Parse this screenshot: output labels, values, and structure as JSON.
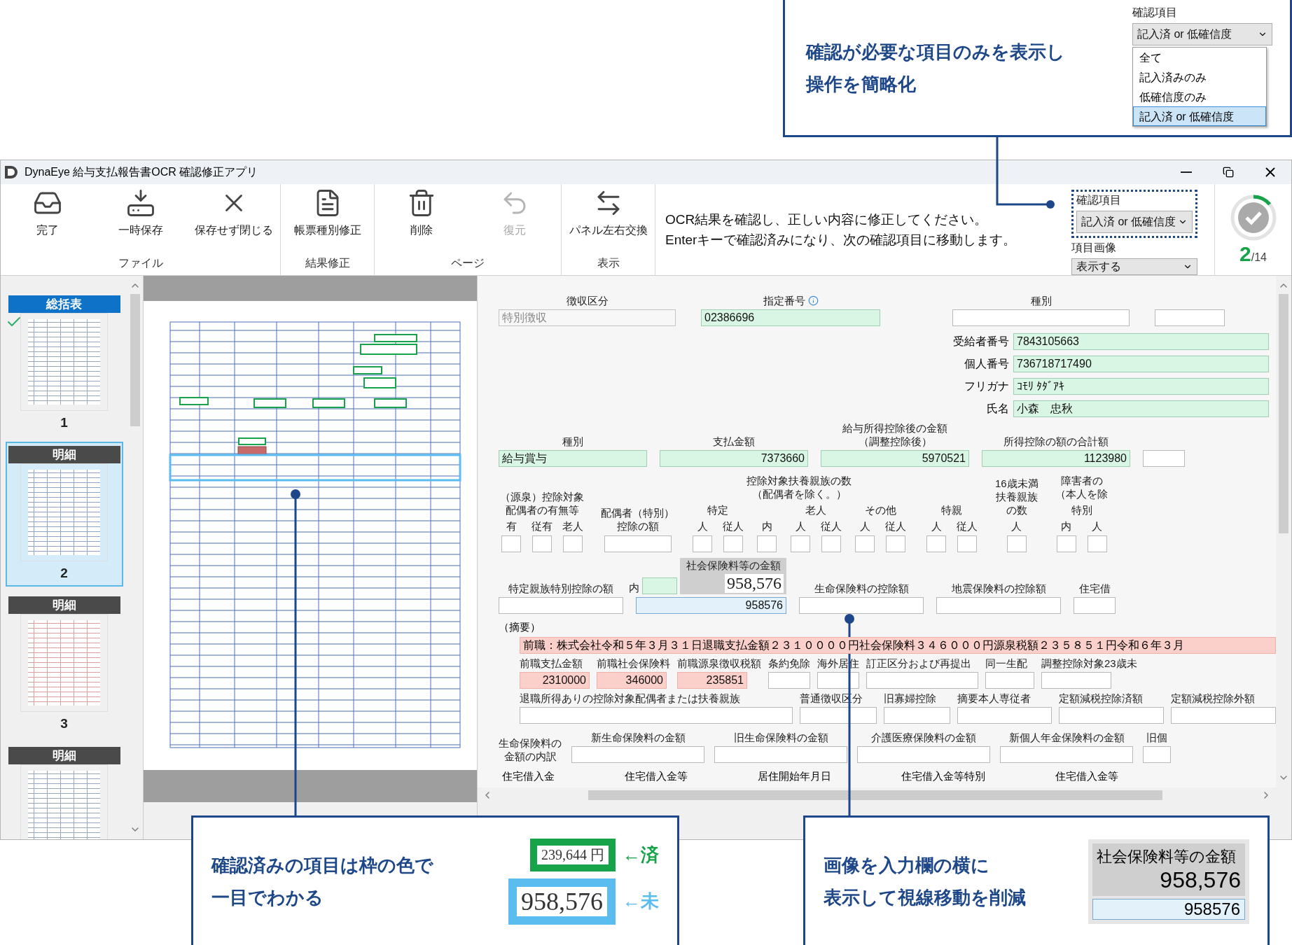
{
  "callout_top": {
    "lines": [
      "確認が必要な項目のみを表示し",
      "操作を簡略化"
    ],
    "dropdown": {
      "label": "確認項目",
      "value": "記入済 or 低確信度",
      "options": [
        {
          "label": "全て",
          "selected": false
        },
        {
          "label": "記入済みのみ",
          "selected": false
        },
        {
          "label": "低確信度のみ",
          "selected": false
        },
        {
          "label": "記入済 or 低確信度",
          "selected": true
        }
      ]
    }
  },
  "window": {
    "title": "DynaEye 給与支払報告書OCR 確認修正アプリ"
  },
  "toolbar": {
    "groups": [
      {
        "label": "ファイル",
        "buttons": [
          {
            "label": "完了",
            "disabled": false
          },
          {
            "label": "一時保存",
            "disabled": false
          },
          {
            "label": "保存せず閉じる",
            "disabled": false
          }
        ]
      },
      {
        "label": "結果修正",
        "buttons": [
          {
            "label": "帳票種別修正",
            "disabled": false
          }
        ]
      },
      {
        "label": "ページ",
        "buttons": [
          {
            "label": "削除",
            "disabled": false
          },
          {
            "label": "復元",
            "disabled": true
          }
        ]
      },
      {
        "label": "表示",
        "buttons": [
          {
            "label": "パネル左右交換",
            "disabled": false
          }
        ]
      }
    ],
    "message_lines": [
      "OCR結果を確認し、正しい内容に修正してください。",
      "Enterキーで確認済みになり、次の確認項目に移動します。"
    ],
    "filter": {
      "label": "確認項目",
      "value": "記入済 or 低確信度"
    },
    "image_option": {
      "label": "項目画像",
      "value": "表示する"
    },
    "progress": {
      "current": "2",
      "total": "/14",
      "level": 0.14
    }
  },
  "thumbnails": [
    {
      "kind": "summary",
      "header": "総括表",
      "number": "1",
      "checked": true,
      "selected": false
    },
    {
      "kind": "detail",
      "header": "明細",
      "number": "2",
      "checked": false,
      "selected": true
    },
    {
      "kind": "detail",
      "header": "明細",
      "number": "3",
      "checked": false,
      "selected": false
    },
    {
      "kind": "detail",
      "header": "明細",
      "checked": false,
      "selected": false
    }
  ],
  "form": {
    "top_row": [
      {
        "label": "徴収区分",
        "value": "特別徴収",
        "kind": "readonly",
        "info": false
      },
      {
        "label": "指定番号",
        "value": "02386696",
        "kind": "confirmed",
        "info": true
      },
      {
        "label": "種別",
        "kind": "blank",
        "info": false
      },
      {
        "kind": "blank",
        "info": false
      }
    ],
    "person_rows": [
      {
        "label": "受給者番号",
        "value": "7843105663",
        "kind": "confirmed"
      },
      {
        "label": "個人番号",
        "value": "736718717490",
        "kind": "confirmed"
      },
      {
        "label": "フリガナ",
        "value": "ｺﾓﾘ ﾀﾀﾞｱｷ",
        "kind": "confirmed"
      },
      {
        "label": "氏名",
        "value": "小森　忠秋",
        "kind": "confirmed"
      }
    ],
    "amount_row": [
      {
        "label": "種別",
        "value": "給与賞与",
        "kind": "confirmed"
      },
      {
        "label": "支払金額",
        "value": "7373660",
        "kind": "confirmed"
      },
      {
        "label": [
          "給与所得控除後の金額",
          "（調整控除後）"
        ],
        "value": "5970521",
        "kind": "confirmed"
      },
      {
        "label": "所得控除の額の合計額",
        "value": "1123980",
        "kind": "confirmed"
      },
      {
        "kind": "blank"
      }
    ],
    "dependents": [
      {
        "title": [
          "（源泉）控除対象",
          "配偶者の有無等"
        ],
        "subgroups": [
          {
            "columns": [
              "有",
              "従有",
              "老人"
            ]
          }
        ]
      },
      {
        "title": [
          "配偶者（特別）",
          "控除の額"
        ]
      },
      {
        "title": [
          "控除対象扶養親族の数",
          "（配偶者を除く。）"
        ],
        "subgroups": [
          {
            "title": "特定",
            "columns": [
              "人",
              "従人"
            ]
          },
          {
            "columns": [
              "内"
            ]
          },
          {
            "title": "老人",
            "columns": [
              "人",
              "従人"
            ]
          },
          {
            "title": "その他",
            "columns": [
              "人",
              "従人"
            ]
          }
        ]
      },
      {
        "subgroups": [
          {
            "title": "特親",
            "columns": [
              "人",
              "従人"
            ]
          }
        ]
      },
      {
        "title": [
          "16歳未満",
          "扶養親族",
          "の数"
        ],
        "subgroups": [
          {
            "columns": [
              "人"
            ]
          }
        ]
      },
      {
        "title": [
          "障害者の",
          "（本人を除"
        ],
        "subgroups": [
          {
            "title": "特別",
            "columns": [
              "内",
              "人"
            ]
          }
        ]
      }
    ],
    "insurance_row": [
      {
        "label": "特定親族特別控除の額",
        "kind": "blank"
      },
      {
        "inner": {
          "label": "内",
          "kind": "confirmed"
        },
        "image": {
          "caption": "社会保険料等の金額",
          "value": "958,576"
        },
        "value": "958576",
        "kind": "focused"
      },
      {
        "label": "生命保険料の控除額",
        "kind": "blank"
      },
      {
        "label": "地震保険料の控除額",
        "kind": "blank"
      },
      {
        "label": "住宅借",
        "kind": "blank"
      }
    ],
    "summary": {
      "label": "（摘要）",
      "text": "前職：株式会社令和５年３月３１日退職支払金額２３１００００円社会保険料３４６０００円源泉税額２３５８５１円令和６年３月",
      "kind": "flagged"
    },
    "field_rows": [
      [
        {
          "label": "前職支払金額",
          "value": "2310000",
          "kind": "flagged"
        },
        {
          "label": "前職社会保険料",
          "value": "346000",
          "kind": "flagged"
        },
        {
          "label": "前職源泉徴収税額",
          "value": "235851",
          "kind": "flagged"
        },
        {
          "label": "条約免除",
          "kind": "blank"
        },
        {
          "label": "海外居住",
          "kind": "blank"
        },
        {
          "label": "訂正区分および再提出",
          "kind": "blank"
        },
        {
          "label": "同一生配",
          "kind": "blank"
        },
        {
          "label": "調整控除対象23歳未",
          "kind": "blank"
        }
      ],
      [
        {
          "label": "退職所得ありの控除対象配偶者または扶養親族",
          "kind": "blank"
        },
        {
          "label": "普通徴収区分",
          "kind": "blank"
        },
        {
          "label": "旧寡婦控除",
          "kind": "blank"
        },
        {
          "label": "摘要本人専従者",
          "kind": "blank"
        },
        {
          "label": "定額減税控除済額",
          "kind": "blank"
        },
        {
          "label": "定額減税控除外額",
          "kind": "blank"
        }
      ]
    ],
    "life_row": {
      "label": [
        "生命保険料の",
        "金額の内訳"
      ],
      "fields": [
        {
          "label": "新生命保険料の金額",
          "kind": "blank"
        },
        {
          "label": "旧生命保険料の金額",
          "kind": "blank"
        },
        {
          "label": "介護医療保険料の金額",
          "kind": "blank"
        },
        {
          "label": "新個人年金保険料の金額",
          "kind": "blank"
        },
        {
          "label": "旧個",
          "kind": "blank"
        }
      ]
    },
    "housing_labels": [
      "住宅借入金",
      "住宅借入金等",
      "居住開始年月日",
      "住宅借入金等特別",
      "住宅借入金等"
    ]
  },
  "callout_left": {
    "lines": [
      "確認済みの項目は枠の色で",
      "一目でわかる"
    ],
    "legend": [
      {
        "sample": "239,644 円",
        "mark": "←済",
        "color": "#16a34a"
      },
      {
        "sample": "958,576",
        "mark": "←未",
        "color": "#5bbcef"
      }
    ]
  },
  "callout_right": {
    "lines": [
      "画像を入力欄の横に",
      "表示して視線移動を削減"
    ],
    "image_caption": "社会保険料等の金額",
    "image_value": "958,576",
    "value": "958576"
  }
}
